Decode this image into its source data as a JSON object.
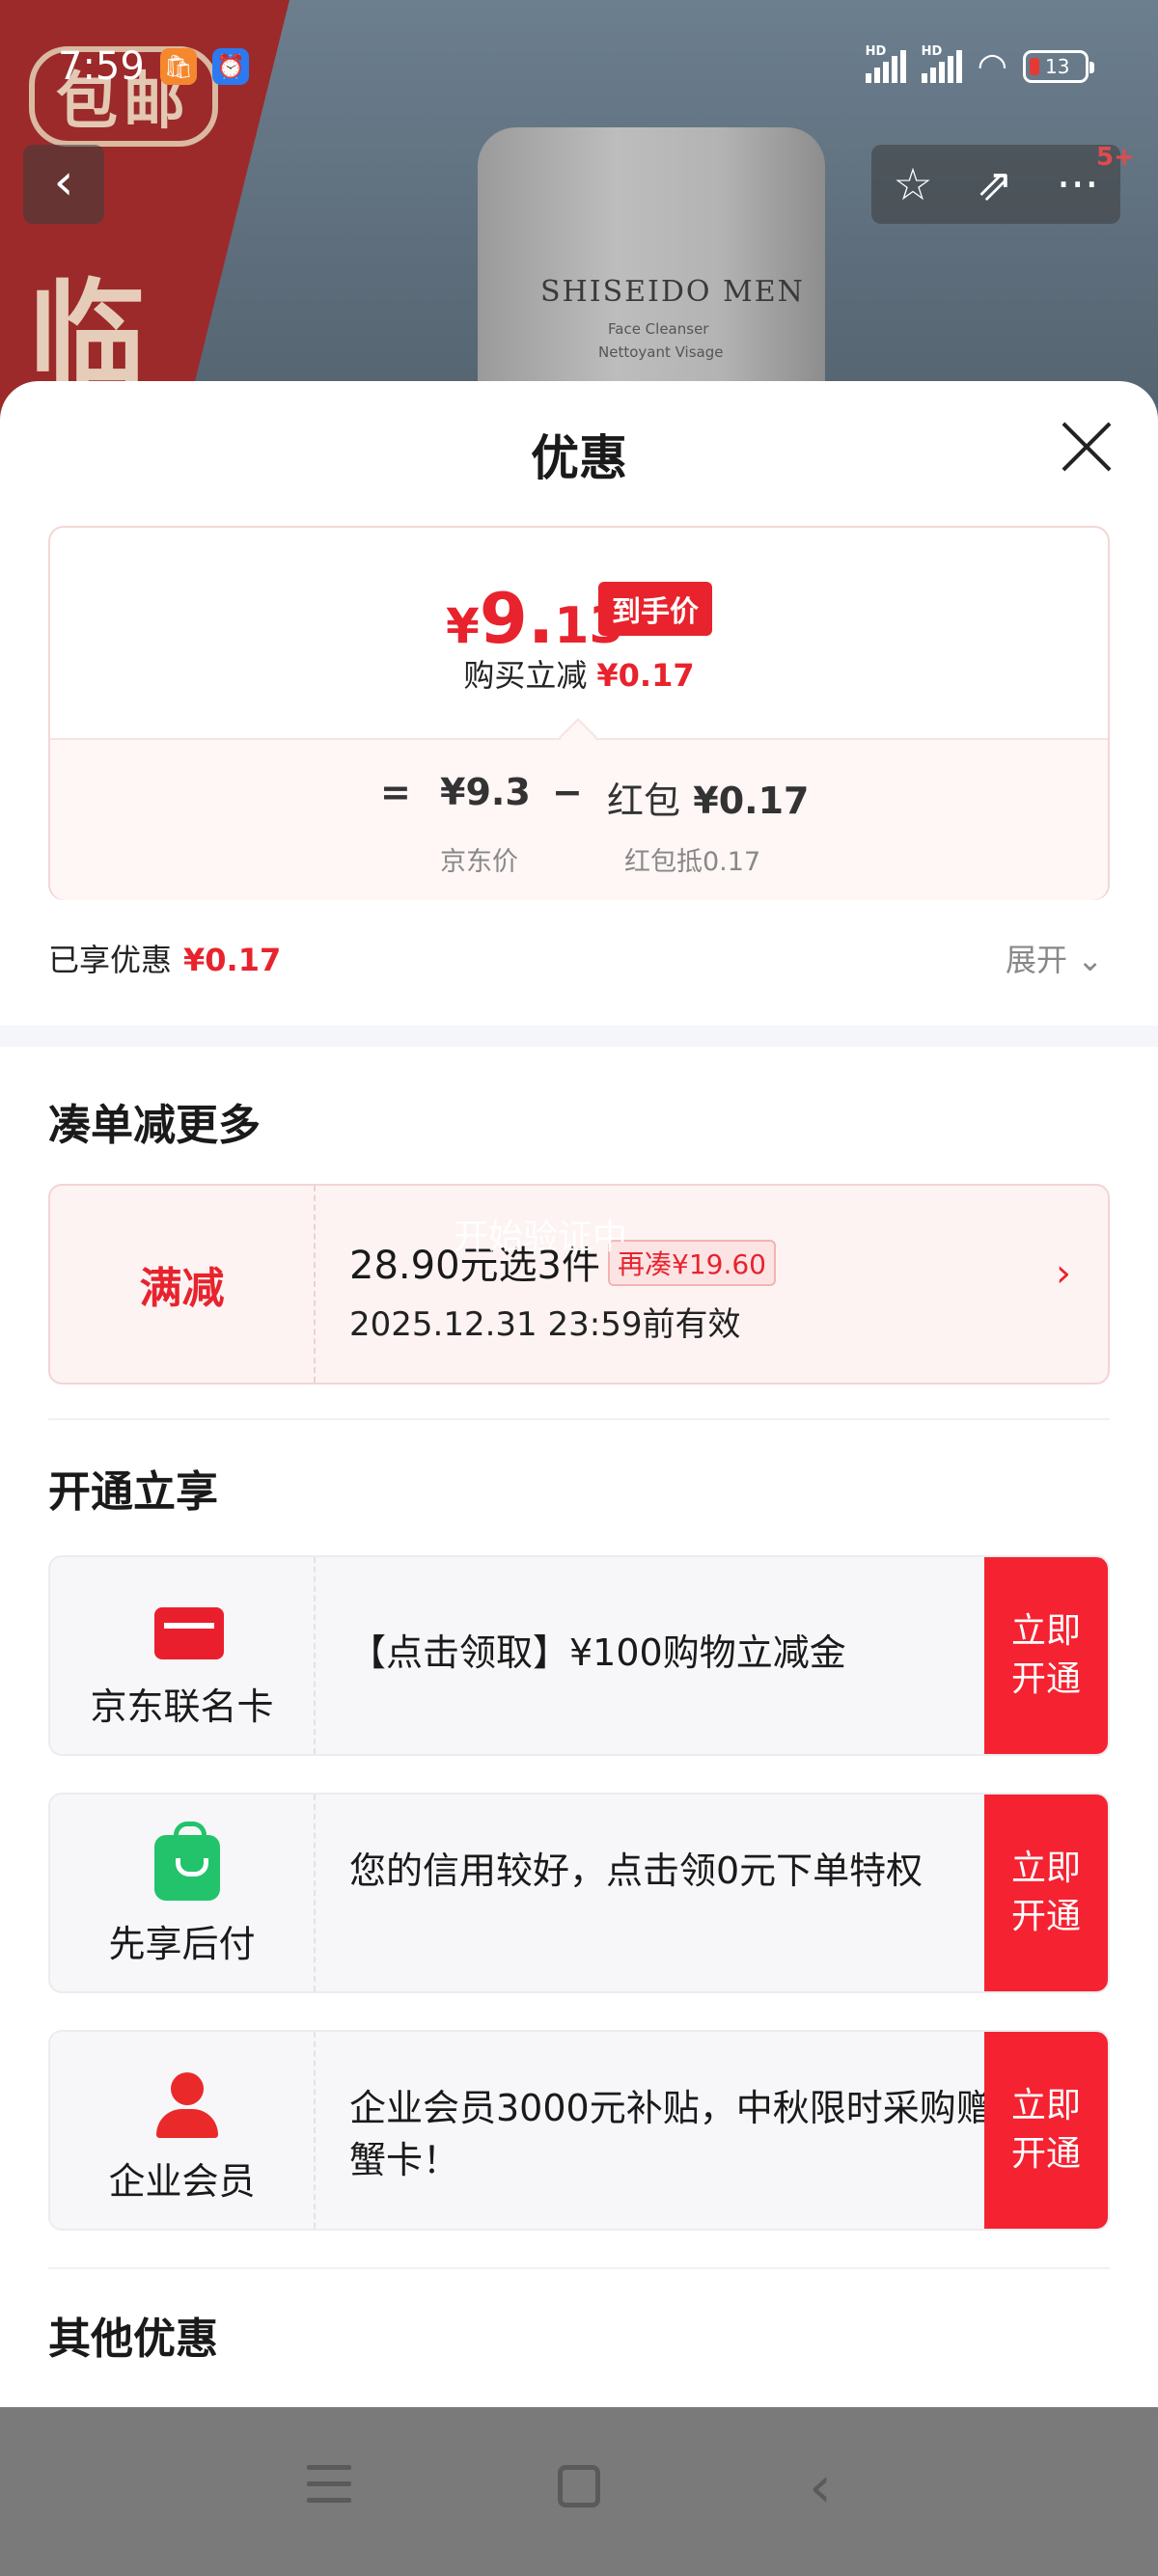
{
  "status_bar": {
    "time": "7:59",
    "network_label": "HD",
    "battery": "13"
  },
  "background": {
    "badge_text": "包邮",
    "banner_glyph": "临",
    "product_brand": "SHISEIDO MEN",
    "product_sub1": "Face Cleanser",
    "product_sub2": "Nettoyant Visage"
  },
  "top_nav": {
    "back_icon": "chevron-left-icon",
    "favorite_icon": "star-icon",
    "share_icon": "share-icon",
    "more_icon": "more-icon",
    "notification_count": "5+"
  },
  "sheet": {
    "title": "优惠",
    "close_icon": "close-icon"
  },
  "price_card": {
    "currency": "¥",
    "price_int": "9.",
    "price_dec": "13",
    "final_tag": "到手价",
    "instant_cut_label": "购买立减",
    "instant_cut_value": "¥0.17",
    "eq": "=",
    "jd_price": "¥9.3",
    "minus": "−",
    "hongbao_label": "红包",
    "hongbao_value": "¥0.17",
    "jd_price_label": "京东价",
    "hongbao_sub": "红包抵0.17"
  },
  "summary": {
    "enjoyed_label": "已享优惠",
    "enjoyed_value": "¥0.17",
    "expand_label": "展开"
  },
  "section_more": {
    "title": "凑单减更多",
    "promo": {
      "tag": "满减",
      "text": "28.90元选3件",
      "pill": "再凑¥19.60",
      "date": "2025.12.31 23:59前有效",
      "overlay": "开始验证中"
    }
  },
  "section_open": {
    "title": "开通立享",
    "items": [
      {
        "name": "京东联名卡",
        "desc": "【点击领取】¥100购物立减金",
        "button": "立即开通"
      },
      {
        "name": "先享后付",
        "desc": "您的信用较好，点击领0元下单特权",
        "button": "立即开通"
      },
      {
        "name": "企业会员",
        "desc": "企业会员3000元补贴，中秋限时采购赠蟹卡！",
        "button": "立即开通"
      }
    ]
  },
  "section_other": {
    "title": "其他优惠"
  },
  "colors": {
    "accent_red": "#e8232d",
    "button_red": "#f52231",
    "green": "#22c36b"
  }
}
